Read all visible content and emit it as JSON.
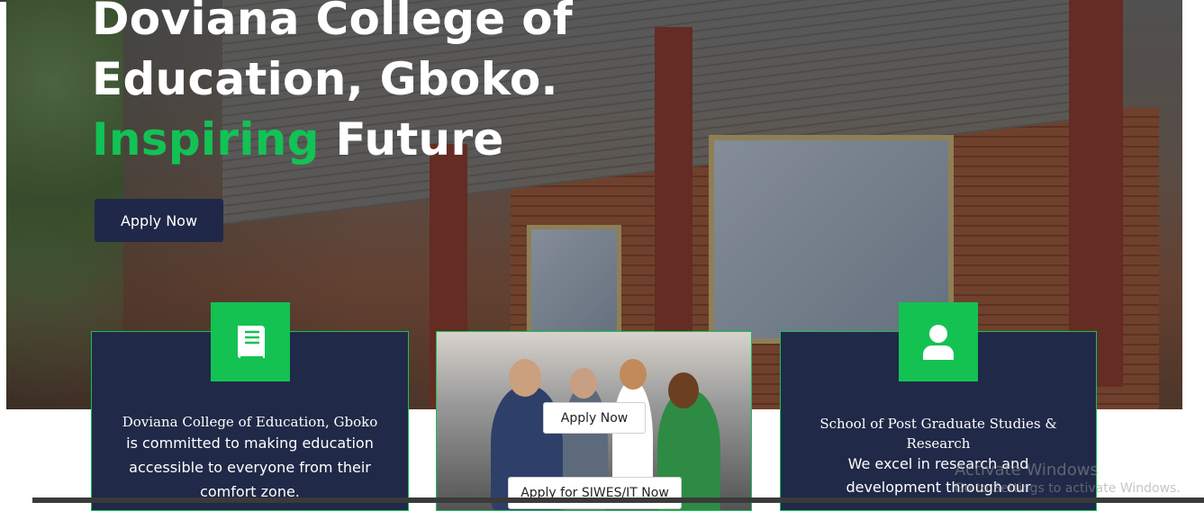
{
  "hero": {
    "title_line1": "Doviana College of",
    "title_line2": "Education, Gboko.",
    "tagline_highlight": "Inspiring",
    "tagline_rest": " Future",
    "apply_button": "Apply Now"
  },
  "cards": {
    "college": {
      "icon": "book-icon",
      "title": "Doviana College of Education, Gboko",
      "body": "is committed to making education accessible to everyone from their comfort zone."
    },
    "students": {
      "apply_button": "Apply Now",
      "siwes_button": "Apply for SIWES/IT Now"
    },
    "postgrad": {
      "icon": "user-icon",
      "title": "School of Post Graduate Studies & Research",
      "body": "We excel in research and development through our"
    }
  },
  "watermark": {
    "title": "Activate Windows",
    "subtitle": "Go to Settings to activate Windows."
  },
  "colors": {
    "navy": "#202948",
    "green": "#13c255",
    "button_navy": "#1f2848"
  }
}
